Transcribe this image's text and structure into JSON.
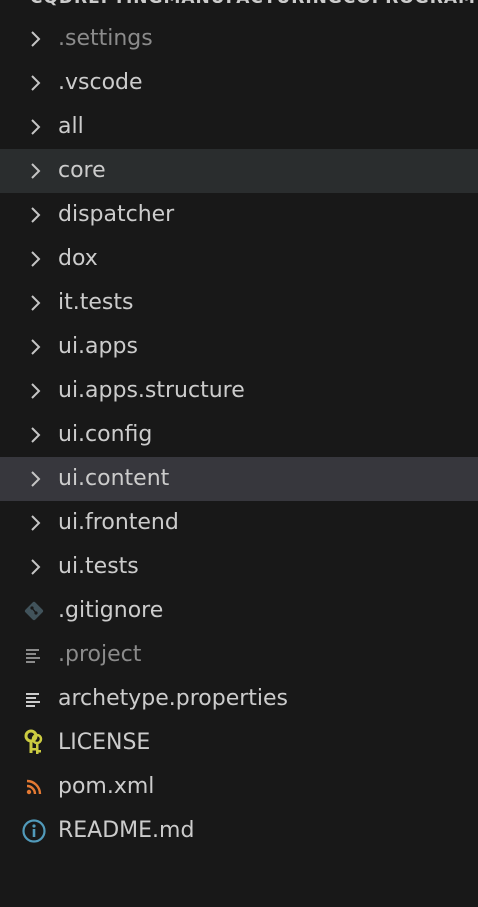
{
  "explorer": {
    "header_title": "CQDREFTINGMANUFACTURINGCOPROGRAM"
  },
  "tree": {
    "items": [
      {
        "label": ".settings",
        "type": "folder",
        "dim": true
      },
      {
        "label": ".vscode",
        "type": "folder"
      },
      {
        "label": "all",
        "type": "folder"
      },
      {
        "label": "core",
        "type": "folder",
        "state": "hover"
      },
      {
        "label": "dispatcher",
        "type": "folder"
      },
      {
        "label": "dox",
        "type": "folder"
      },
      {
        "label": "it.tests",
        "type": "folder"
      },
      {
        "label": "ui.apps",
        "type": "folder"
      },
      {
        "label": "ui.apps.structure",
        "type": "folder"
      },
      {
        "label": "ui.config",
        "type": "folder"
      },
      {
        "label": "ui.content",
        "type": "folder",
        "state": "selected"
      },
      {
        "label": "ui.frontend",
        "type": "folder"
      },
      {
        "label": "ui.tests",
        "type": "folder"
      },
      {
        "label": ".gitignore",
        "type": "file",
        "icon": "git-icon",
        "color": "#41535b"
      },
      {
        "label": ".project",
        "type": "file",
        "icon": "lines-icon",
        "color": "#8b8b8b",
        "dim": true
      },
      {
        "label": "archetype.properties",
        "type": "file",
        "icon": "lines-icon",
        "color": "#cccccc"
      },
      {
        "label": "LICENSE",
        "type": "file",
        "icon": "license-key-icon",
        "color": "#cbcb41"
      },
      {
        "label": "pom.xml",
        "type": "file",
        "icon": "rss-icon",
        "color": "#e37933"
      },
      {
        "label": "README.md",
        "type": "file",
        "icon": "info-icon",
        "color": "#519aba"
      }
    ]
  }
}
